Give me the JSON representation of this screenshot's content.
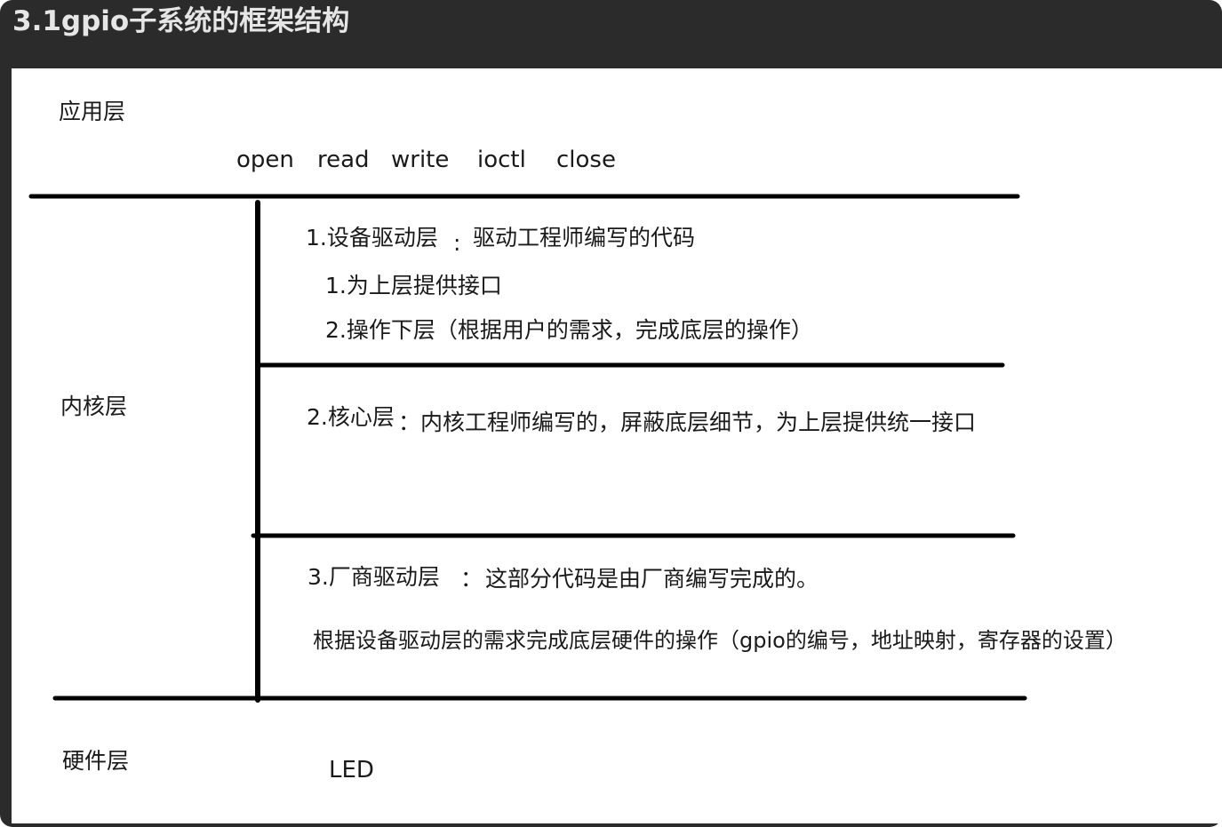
{
  "header": {
    "title": "3.1gpio子系统的框架结构"
  },
  "layers": {
    "application": "应用层",
    "kernel": "内核层",
    "hardware": "硬件层"
  },
  "app_calls": [
    "open",
    "read",
    "write",
    "ioctl",
    "close"
  ],
  "device_driver": {
    "heading": "1.设备驱动层",
    "separator": ":",
    "description": "驱动工程师编写的代码",
    "point1": "1.为上层提供接口",
    "point2": "2.操作下层（根据用户的需求，完成底层的操作）"
  },
  "core": {
    "heading": "2.核心层",
    "text": "：内核工程师编写的，屏蔽底层细节，为上层提供统一接口"
  },
  "vendor": {
    "heading": "3.厂商驱动层",
    "separator": "：",
    "description": "这部分代码是由厂商编写完成的。",
    "detail": "根据设备驱动层的需求完成底层硬件的操作（gpio的编号，地址映射，寄存器的设置）"
  },
  "hardware_item": "LED",
  "colors": {
    "frame": "#2b2b2b",
    "title_text": "#e6e6e6",
    "canvas": "#ffffff",
    "ink": "#000000",
    "text": "#1a1a1a"
  }
}
